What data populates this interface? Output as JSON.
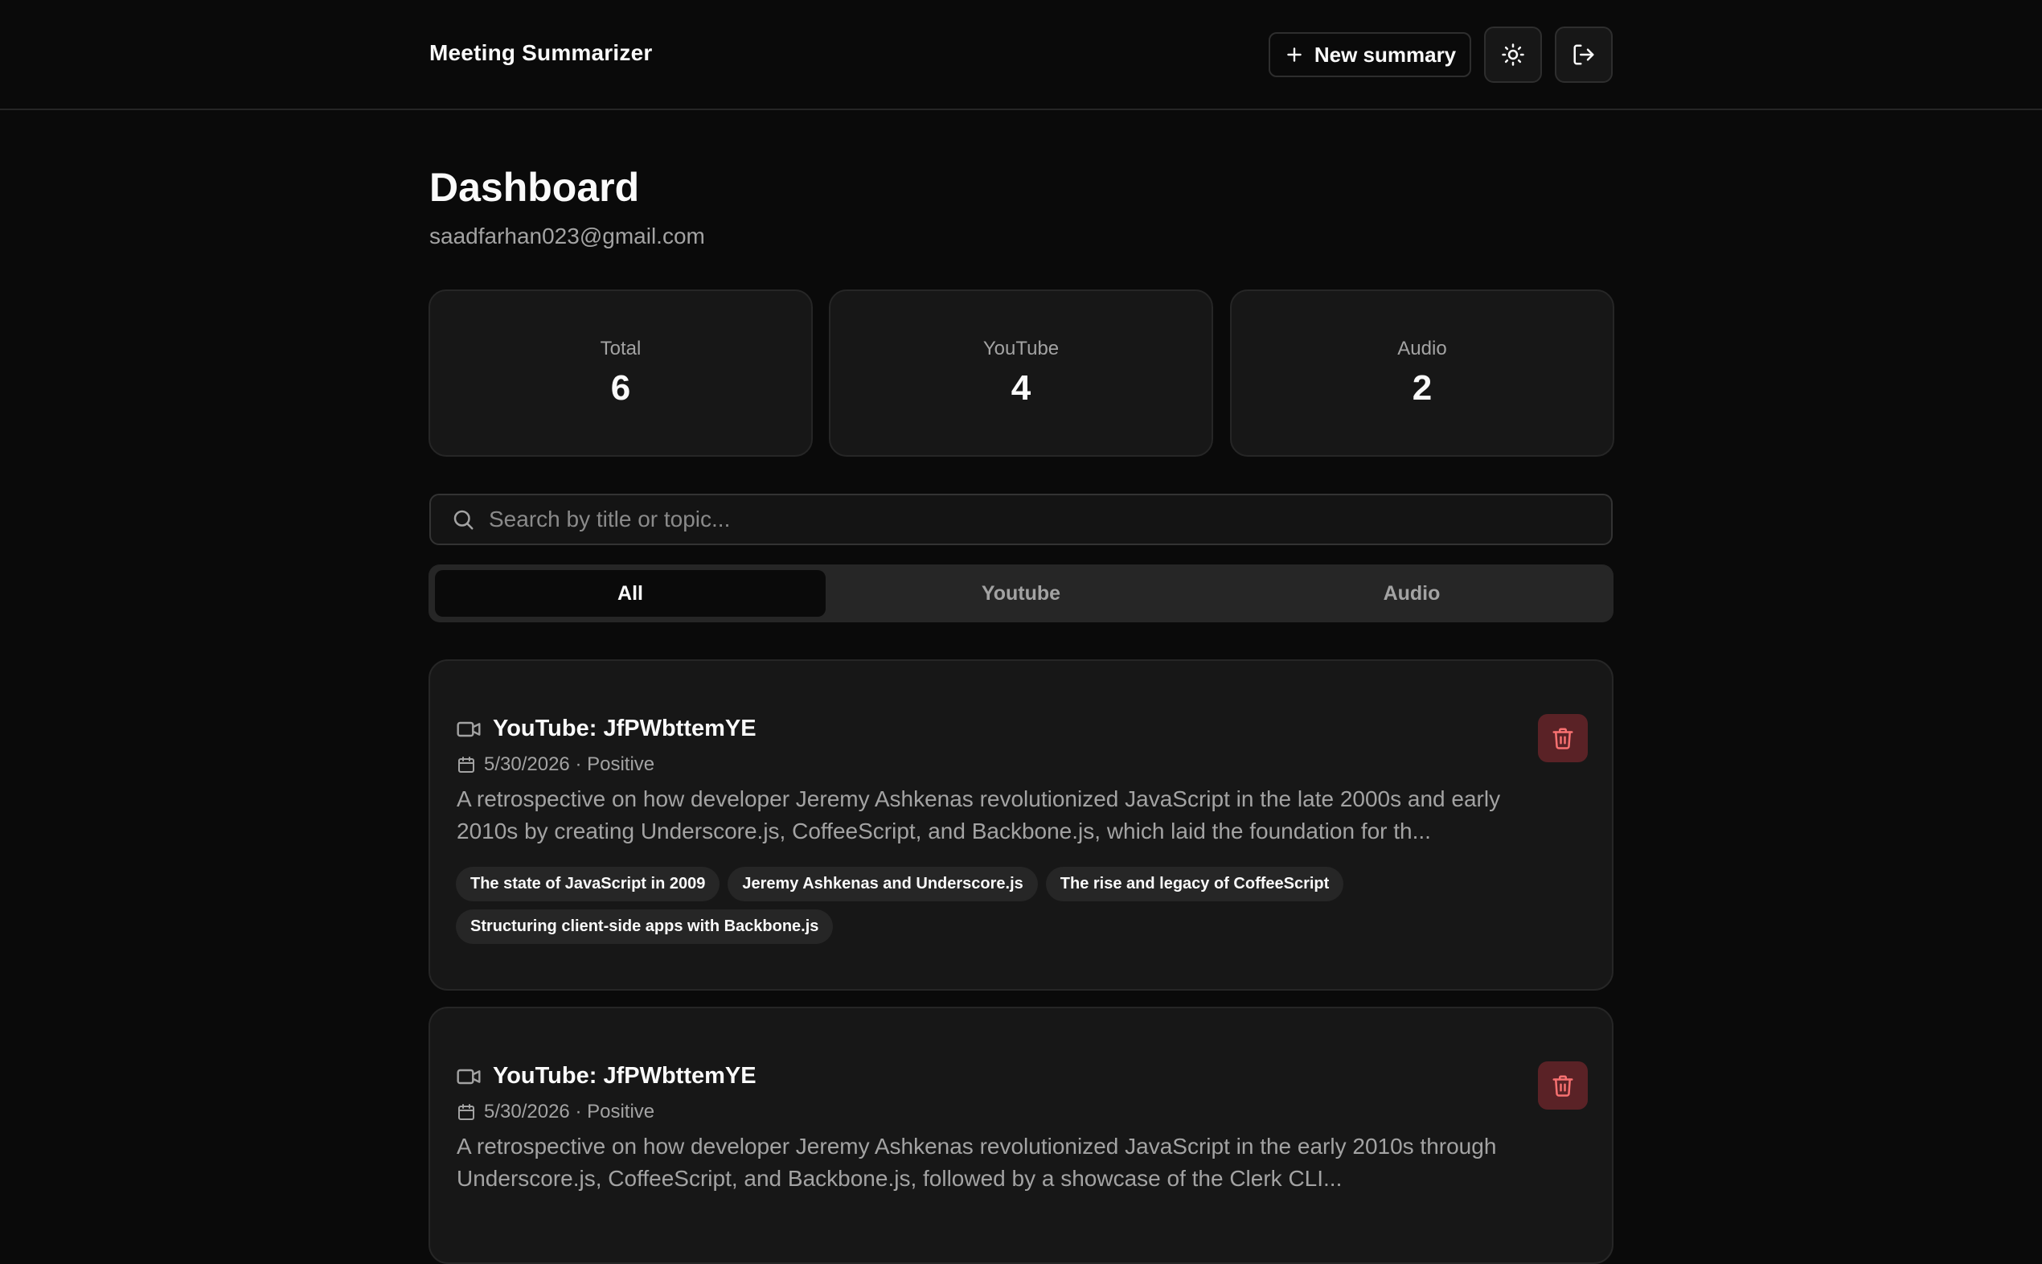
{
  "header": {
    "brand": "Meeting Summarizer",
    "new_summary_label": "New summary",
    "theme_icon": "sun-icon",
    "logout_icon": "logout-icon"
  },
  "page": {
    "title": "Dashboard",
    "email": "saadfarhan023@gmail.com"
  },
  "stats": [
    {
      "label": "Total",
      "value": "6"
    },
    {
      "label": "YouTube",
      "value": "4"
    },
    {
      "label": "Audio",
      "value": "2"
    }
  ],
  "search": {
    "placeholder": "Search by title or topic...",
    "value": ""
  },
  "tabs": [
    {
      "label": "All",
      "active": true
    },
    {
      "label": "Youtube",
      "active": false
    },
    {
      "label": "Audio",
      "active": false
    }
  ],
  "summaries": [
    {
      "title": "YouTube: JfPWbttemYE",
      "date": "5/30/2026",
      "sentiment": "Positive",
      "meta": "5/30/2026 · Positive",
      "summary": "A retrospective on how developer Jeremy Ashkenas revolutionized JavaScript in the late 2000s and early 2010s by creating Underscore.js, CoffeeScript, and Backbone.js, which laid the foundation for th...",
      "tags": [
        "The state of JavaScript in 2009",
        "Jeremy Ashkenas and Underscore.js",
        "The rise and legacy of CoffeeScript",
        "Structuring client-side apps with Backbone.js"
      ]
    },
    {
      "title": "YouTube: JfPWbttemYE",
      "date": "5/30/2026",
      "sentiment": "Positive",
      "meta": "5/30/2026 · Positive",
      "summary": "A retrospective on how developer Jeremy Ashkenas revolutionized JavaScript in the early 2010s through Underscore.js, CoffeeScript, and Backbone.js, followed by a showcase of the Clerk CLI...",
      "tags": []
    }
  ],
  "colors": {
    "background": "#0a0a0a",
    "card": "#171717",
    "border": "#262626",
    "muted_text": "#a3a3a3",
    "danger_bg": "#5a2226",
    "danger_icon": "#f87171"
  }
}
